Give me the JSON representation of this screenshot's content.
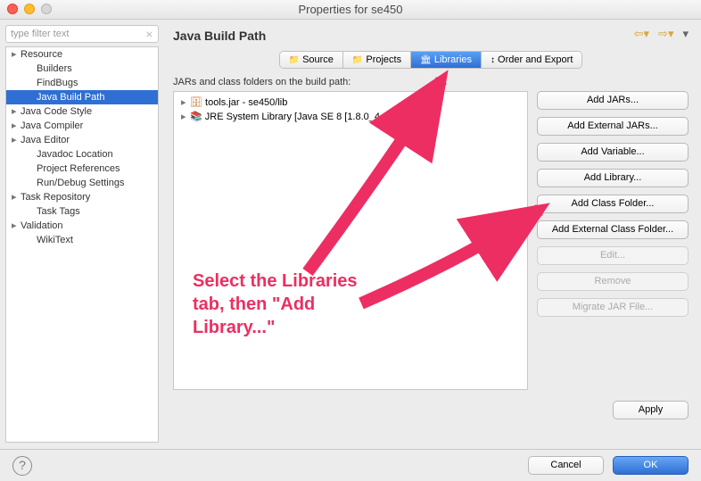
{
  "window": {
    "title": "Properties for se450"
  },
  "sidebar": {
    "filter_placeholder": "type filter text",
    "items": [
      {
        "label": "Resource",
        "indent": 0,
        "expandable": true
      },
      {
        "label": "Builders",
        "indent": 1
      },
      {
        "label": "FindBugs",
        "indent": 1
      },
      {
        "label": "Java Build Path",
        "indent": 1,
        "selected": true
      },
      {
        "label": "Java Code Style",
        "indent": 0,
        "expandable": true
      },
      {
        "label": "Java Compiler",
        "indent": 0,
        "expandable": true
      },
      {
        "label": "Java Editor",
        "indent": 0,
        "expandable": true
      },
      {
        "label": "Javadoc Location",
        "indent": 1
      },
      {
        "label": "Project References",
        "indent": 1
      },
      {
        "label": "Run/Debug Settings",
        "indent": 1
      },
      {
        "label": "Task Repository",
        "indent": 0,
        "expandable": true
      },
      {
        "label": "Task Tags",
        "indent": 1
      },
      {
        "label": "Validation",
        "indent": 0,
        "expandable": true
      },
      {
        "label": "WikiText",
        "indent": 1
      }
    ]
  },
  "page": {
    "title": "Java Build Path",
    "tabs": {
      "source": "Source",
      "projects": "Projects",
      "libraries": "Libraries",
      "order": "Order and Export"
    },
    "active_tab": "Libraries",
    "list_label": "JARs and class folders on the build path:",
    "entries": {
      "jar": "tools.jar - se450/lib",
      "jre": "JRE System Library [Java SE 8 [1.8.0_4"
    },
    "buttons": {
      "add_jars": "Add JARs...",
      "add_ext_jars": "Add External JARs...",
      "add_var": "Add Variable...",
      "add_lib": "Add Library...",
      "add_folder": "Add Class Folder...",
      "add_ext_folder": "Add External Class Folder...",
      "edit": "Edit...",
      "remove": "Remove",
      "migrate": "Migrate JAR File..."
    },
    "apply": "Apply"
  },
  "footer": {
    "cancel": "Cancel",
    "ok": "OK"
  },
  "annotation": {
    "line1": "Select the Libraries",
    "line2": "tab, then \"Add",
    "line3": "Library...\""
  }
}
